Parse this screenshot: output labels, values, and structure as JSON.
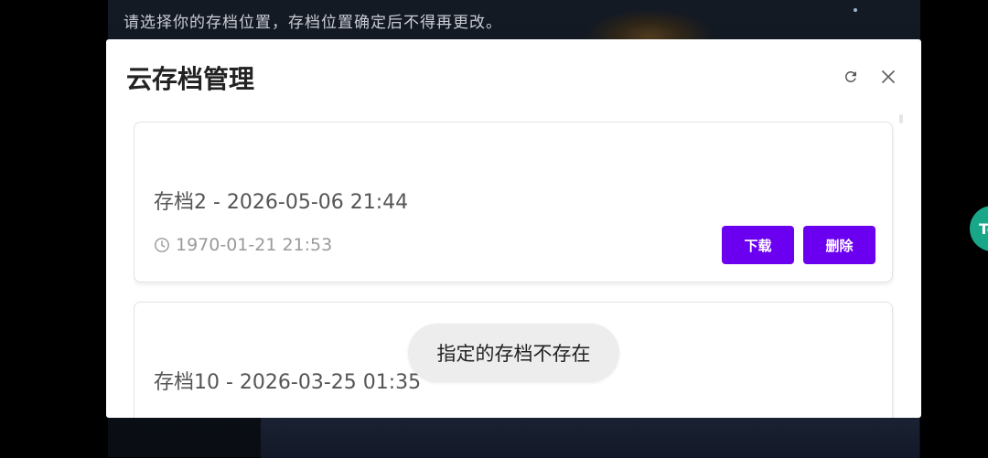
{
  "background": {
    "notice": "请选择你的存档位置，存档位置确定后不得再更改。"
  },
  "dialog": {
    "title": "云存档管理",
    "icons": {
      "refresh": "refresh-icon",
      "close": "close-icon"
    },
    "saves": [
      {
        "title": "存档2 - 2026-05-06 21:44",
        "time": "1970-01-21 21:53",
        "download_label": "下载",
        "delete_label": "删除"
      },
      {
        "title": "存档10 - 2026-03-25 01:35"
      }
    ]
  },
  "toast": {
    "message": "指定的存档不存在"
  },
  "colors": {
    "accent": "#6b00f0"
  }
}
